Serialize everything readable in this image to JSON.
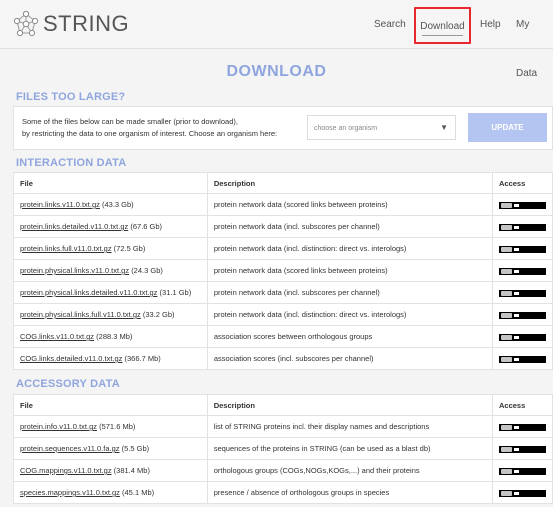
{
  "header": {
    "logo_text": "STRING",
    "nav": {
      "search": "Search",
      "download": "Download",
      "help": "Help",
      "mydata": "My Data"
    }
  },
  "page_title": "DOWNLOAD",
  "files_too_large": {
    "title": "FILES TOO LARGE?",
    "line1": "Some of the files below can be made smaller (prior to download),",
    "line2": "by restricting the data to one organism of interest. Choose an organism here:",
    "select_placeholder": "choose an organism",
    "update_label": "UPDATE"
  },
  "interaction": {
    "title": "INTERACTION DATA",
    "columns": [
      "File",
      "Description",
      "Access"
    ],
    "rows": [
      {
        "file": "protein.links.v11.0.txt.gz",
        "size": "(43.3 Gb)",
        "desc": "protein network data (scored links between proteins)"
      },
      {
        "file": "protein.links.detailed.v11.0.txt.gz",
        "size": "(67.6 Gb)",
        "desc": "protein network data (incl. subscores per channel)"
      },
      {
        "file": "protein.links.full.v11.0.txt.gz",
        "size": "(72.5 Gb)",
        "desc": "protein network data (incl. distinction: direct vs. interologs)"
      },
      {
        "file": "protein.physical.links.v11.0.txt.gz",
        "size": "(24.3 Gb)",
        "desc": "protein network data (scored links between proteins)"
      },
      {
        "file": "protein.physical.links.detailed.v11.0.txt.gz",
        "size": "(31.1 Gb)",
        "desc": "protein network data (incl. subscores per channel)"
      },
      {
        "file": "protein.physical.links.full.v11.0.txt.gz",
        "size": "(33.2 Gb)",
        "desc": "protein network data (incl. distinction: direct vs. interologs)"
      },
      {
        "file": "COG.links.v11.0.txt.gz",
        "size": "(288.3 Mb)",
        "desc": "association scores between orthologous groups"
      },
      {
        "file": "COG.links.detailed.v11.0.txt.gz",
        "size": "(366.7 Mb)",
        "desc": "association scores (incl. subscores per channel)"
      }
    ]
  },
  "accessory": {
    "title": "ACCESSORY DATA",
    "columns": [
      "File",
      "Description",
      "Access"
    ],
    "rows": [
      {
        "file": "protein.info.v11.0.txt.gz",
        "size": "(571.6 Mb)",
        "desc": "list of STRING proteins incl. their display names and descriptions"
      },
      {
        "file": "protein.sequences.v11.0.fa.gz",
        "size": "(5.5 Gb)",
        "desc": "sequences of the proteins in STRING (can be used as a blast db)"
      },
      {
        "file": "COG.mappings.v11.0.txt.gz",
        "size": "(381.4 Mb)",
        "desc": "orthologous groups (COGs,NOGs,KOGs,...) and their proteins"
      },
      {
        "file": "species.mappings.v11.0.txt.gz",
        "size": "(45.1 Mb)",
        "desc": "presence / absence of orthologous groups in species"
      }
    ]
  },
  "icons": {
    "logo": "string-network-icon",
    "license": "cc-by-license-icon",
    "dropdown": "caret-down-icon"
  },
  "colors": {
    "accent": "#8fa5de",
    "button": "#b5c5f1",
    "highlight": "#e8262d"
  }
}
